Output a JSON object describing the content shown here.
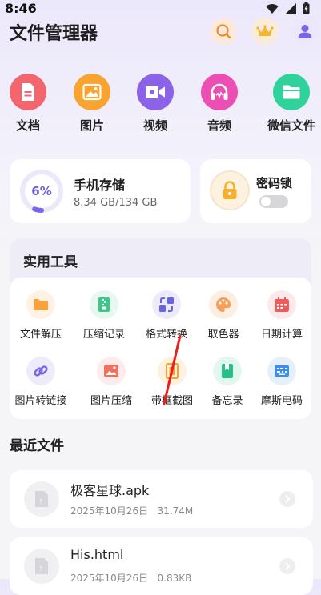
{
  "status_bar": {
    "time": "8:46"
  },
  "header": {
    "title": "文件管理器"
  },
  "categories": [
    {
      "label": "文档",
      "color": "#f4666e",
      "icon": "document-icon"
    },
    {
      "label": "图片",
      "color": "#f9a431",
      "icon": "image-icon"
    },
    {
      "label": "视频",
      "color": "#8a63e8",
      "icon": "video-icon"
    },
    {
      "label": "音频",
      "color": "#ec4fb4",
      "icon": "headphones-icon"
    },
    {
      "label": "微信文件",
      "color": "#2fd29b",
      "icon": "folder-icon"
    }
  ],
  "storage": {
    "title": "手机存储",
    "percent_label": "6%",
    "percent": 0.06,
    "size": "8.34 GB/134 GB"
  },
  "password_lock": {
    "title": "密码锁",
    "enabled": false
  },
  "tools": {
    "title": "实用工具",
    "items": [
      {
        "label": "文件解压",
        "icon": "folder-unzip-icon",
        "color": "#f7a23a",
        "bg": "#fff1e3"
      },
      {
        "label": "压缩记录",
        "icon": "zip-record-icon",
        "color": "#3cc88a",
        "bg": "#e6f8ef"
      },
      {
        "label": "格式转换",
        "icon": "format-convert-icon",
        "color": "#6b64e0",
        "bg": "#ecebfb"
      },
      {
        "label": "取色器",
        "icon": "palette-icon",
        "color": "#f59f5a",
        "bg": "#fdeee2"
      },
      {
        "label": "日期计算",
        "icon": "calendar-icon",
        "color": "#f05a5a",
        "bg": "#fde9e9"
      },
      {
        "label": "图片转链接",
        "icon": "image-link-icon",
        "color": "#7a64e6",
        "bg": "#eeebfb"
      },
      {
        "label": "图片压缩",
        "icon": "image-compress-icon",
        "color": "#f07060",
        "bg": "#fdeceb"
      },
      {
        "label": "带框截图",
        "icon": "frame-screenshot-icon",
        "color": "#f6a02f",
        "bg": "#fef1e0"
      },
      {
        "label": "备忘录",
        "icon": "memo-icon",
        "color": "#27c08a",
        "bg": "#e4f7ef"
      },
      {
        "label": "摩斯电码",
        "icon": "morse-icon",
        "color": "#3a8ef0",
        "bg": "#e5f0fd"
      }
    ]
  },
  "recent": {
    "title": "最近文件",
    "files": [
      {
        "name": "极客星球.apk",
        "date": "2025年10月26日",
        "size": "31.74M"
      },
      {
        "name": "His.html",
        "date": "2025年10月26日",
        "size": "0.83KB"
      }
    ]
  }
}
